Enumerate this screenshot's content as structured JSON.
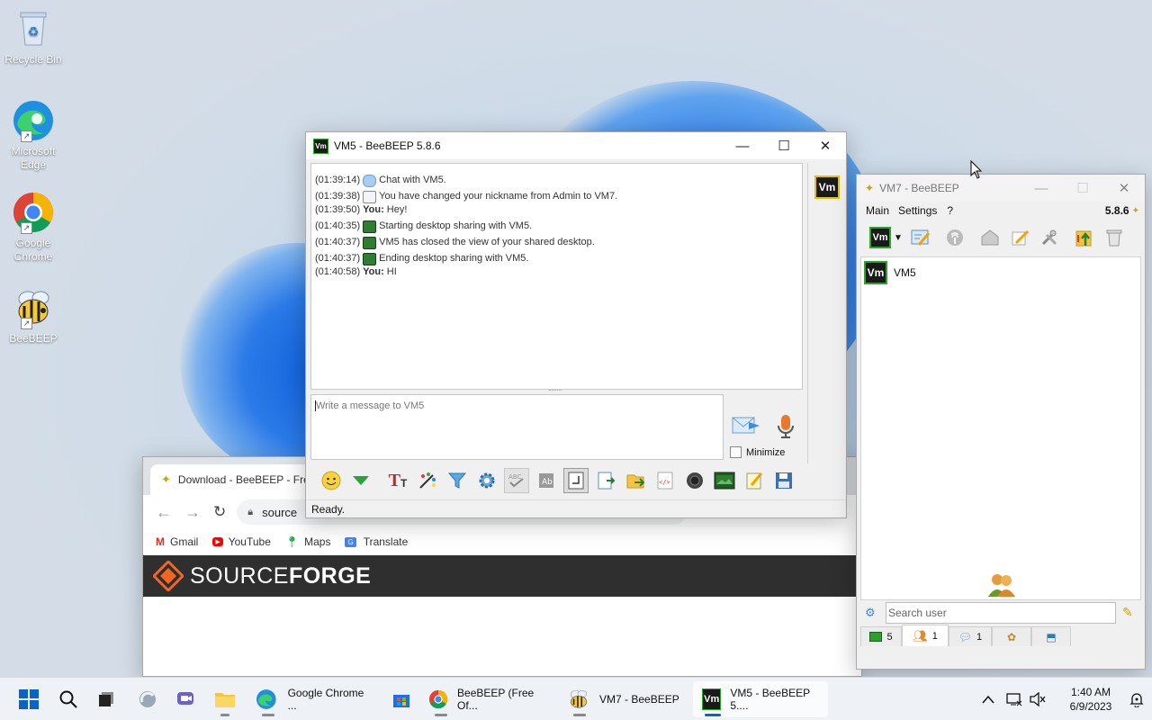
{
  "desktop": {
    "icons": [
      {
        "label": "Recycle Bin"
      },
      {
        "label": "Microsoft Edge"
      },
      {
        "label": "Google Chrome"
      },
      {
        "label": "BeeBEEP"
      }
    ]
  },
  "chrome": {
    "tab_title": "Download - BeeBEEP - Fre",
    "address": "source",
    "bookmarks": [
      "Gmail",
      "YouTube",
      "Maps",
      "Translate"
    ],
    "site_logo_light": "SOURCE",
    "site_logo_bold": "FORGE"
  },
  "vm5_window": {
    "title": "VM5 - BeeBEEP 5.8.6",
    "avatar": "Vm",
    "log": [
      {
        "time": "(01:39:14)",
        "icon": "chat-bubble-icon",
        "who": "",
        "text": "Chat with VM5."
      },
      {
        "time": "(01:39:38)",
        "icon": "profile-card-icon",
        "who": "",
        "text": "You have changed your nickname from Admin to VM7."
      },
      {
        "time": "(01:39:50)",
        "icon": "",
        "who": "You:",
        "text": "Hey!"
      },
      {
        "time": "(01:40:35)",
        "icon": "desktop-share-icon",
        "who": "",
        "text": "Starting desktop sharing with VM5."
      },
      {
        "time": "(01:40:37)",
        "icon": "desktop-share-icon",
        "who": "",
        "text": "VM5 has closed the view of your shared desktop."
      },
      {
        "time": "(01:40:37)",
        "icon": "desktop-share-icon",
        "who": "",
        "text": "Ending desktop sharing with VM5."
      },
      {
        "time": "(01:40:58)",
        "icon": "",
        "who": "You:",
        "text": "HI"
      }
    ],
    "input_placeholder": "Write a message to VM5",
    "minimize_label": "Minimize",
    "status": "Ready."
  },
  "vm7_window": {
    "title": "VM7 - BeeBEEP",
    "menu": [
      "Main",
      "Settings",
      "?"
    ],
    "version": "5.8.6",
    "users": [
      {
        "name": "VM5",
        "avatar": "Vm"
      }
    ],
    "search_placeholder": "Search user",
    "tabs": [
      {
        "icon": "users-online-icon",
        "count": "5"
      },
      {
        "icon": "group-icon",
        "count": "1"
      },
      {
        "icon": "chats-icon",
        "count": "1"
      },
      {
        "icon": "groups-icon",
        "count": ""
      },
      {
        "icon": "network-icon",
        "count": ""
      }
    ]
  },
  "taskbar": {
    "apps": [
      {
        "label": "Google Chrome ..."
      },
      {
        "label": "BeeBEEP (Free Of..."
      },
      {
        "label": "VM7 - BeeBEEP"
      },
      {
        "label": "VM5 - BeeBEEP 5...."
      }
    ],
    "time": "1:40 AM",
    "date": "6/9/2023"
  },
  "colors": {
    "accent": "#0a64c8",
    "sourceforge_bar": "#2f2f2f",
    "sourceforge_orange": "#f26522",
    "vm_badge_border": "#2aa52a"
  }
}
